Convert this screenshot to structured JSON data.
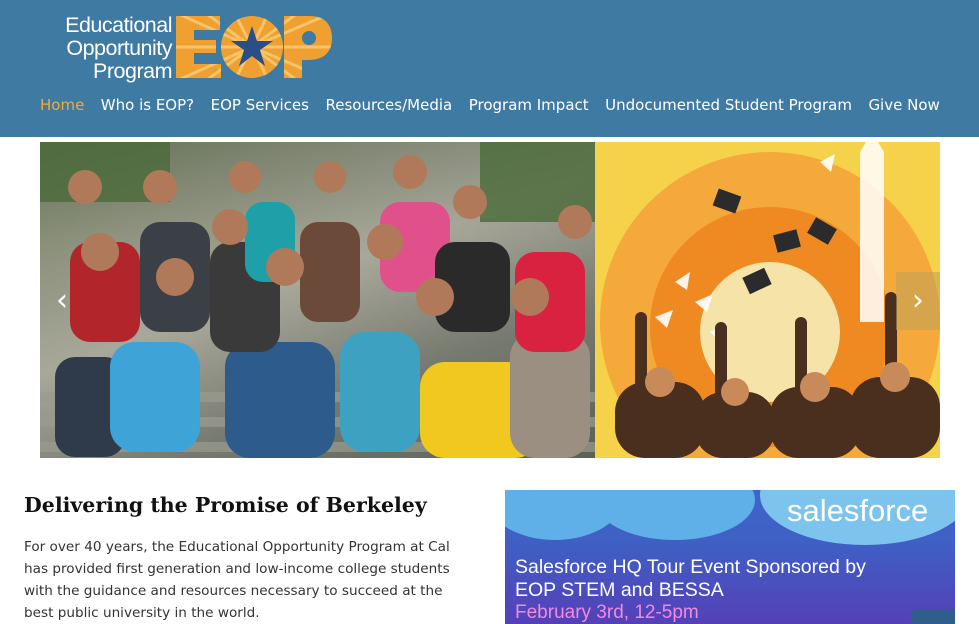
{
  "header": {
    "logo_text": [
      "Educational",
      "Opportunity",
      "Program"
    ],
    "logo_mark": "EOP",
    "colors": {
      "header_bg": "#3f7aa2",
      "accent": "#f4a93a",
      "logo_orange": "#f0a030",
      "star": "#2a4f86"
    }
  },
  "nav": {
    "items": [
      {
        "label": "Home",
        "active": true
      },
      {
        "label": "Who is EOP?"
      },
      {
        "label": "EOP Services"
      },
      {
        "label": "Resources/Media"
      },
      {
        "label": "Program Impact"
      },
      {
        "label": "Undocumented Student Program"
      },
      {
        "label": "Give Now"
      }
    ]
  },
  "slider": {
    "prev_icon": "chevron-left-icon",
    "next_icon": "chevron-right-icon",
    "prev_glyph": "‹",
    "next_glyph": "›"
  },
  "main": {
    "headline": "Delivering the Promise of Berkeley",
    "intro": "For over 40 years, the Educational Opportunity Program at Cal has provided first generation and low-income college students with the guidance and resources necessary to succeed at the best public university in the world."
  },
  "promo": {
    "brand": "salesforce",
    "title_line1": "Salesforce HQ Tour Event Sponsored by",
    "title_line2": "EOP STEM and BESSA",
    "date": "February 3rd, 12-5pm"
  }
}
